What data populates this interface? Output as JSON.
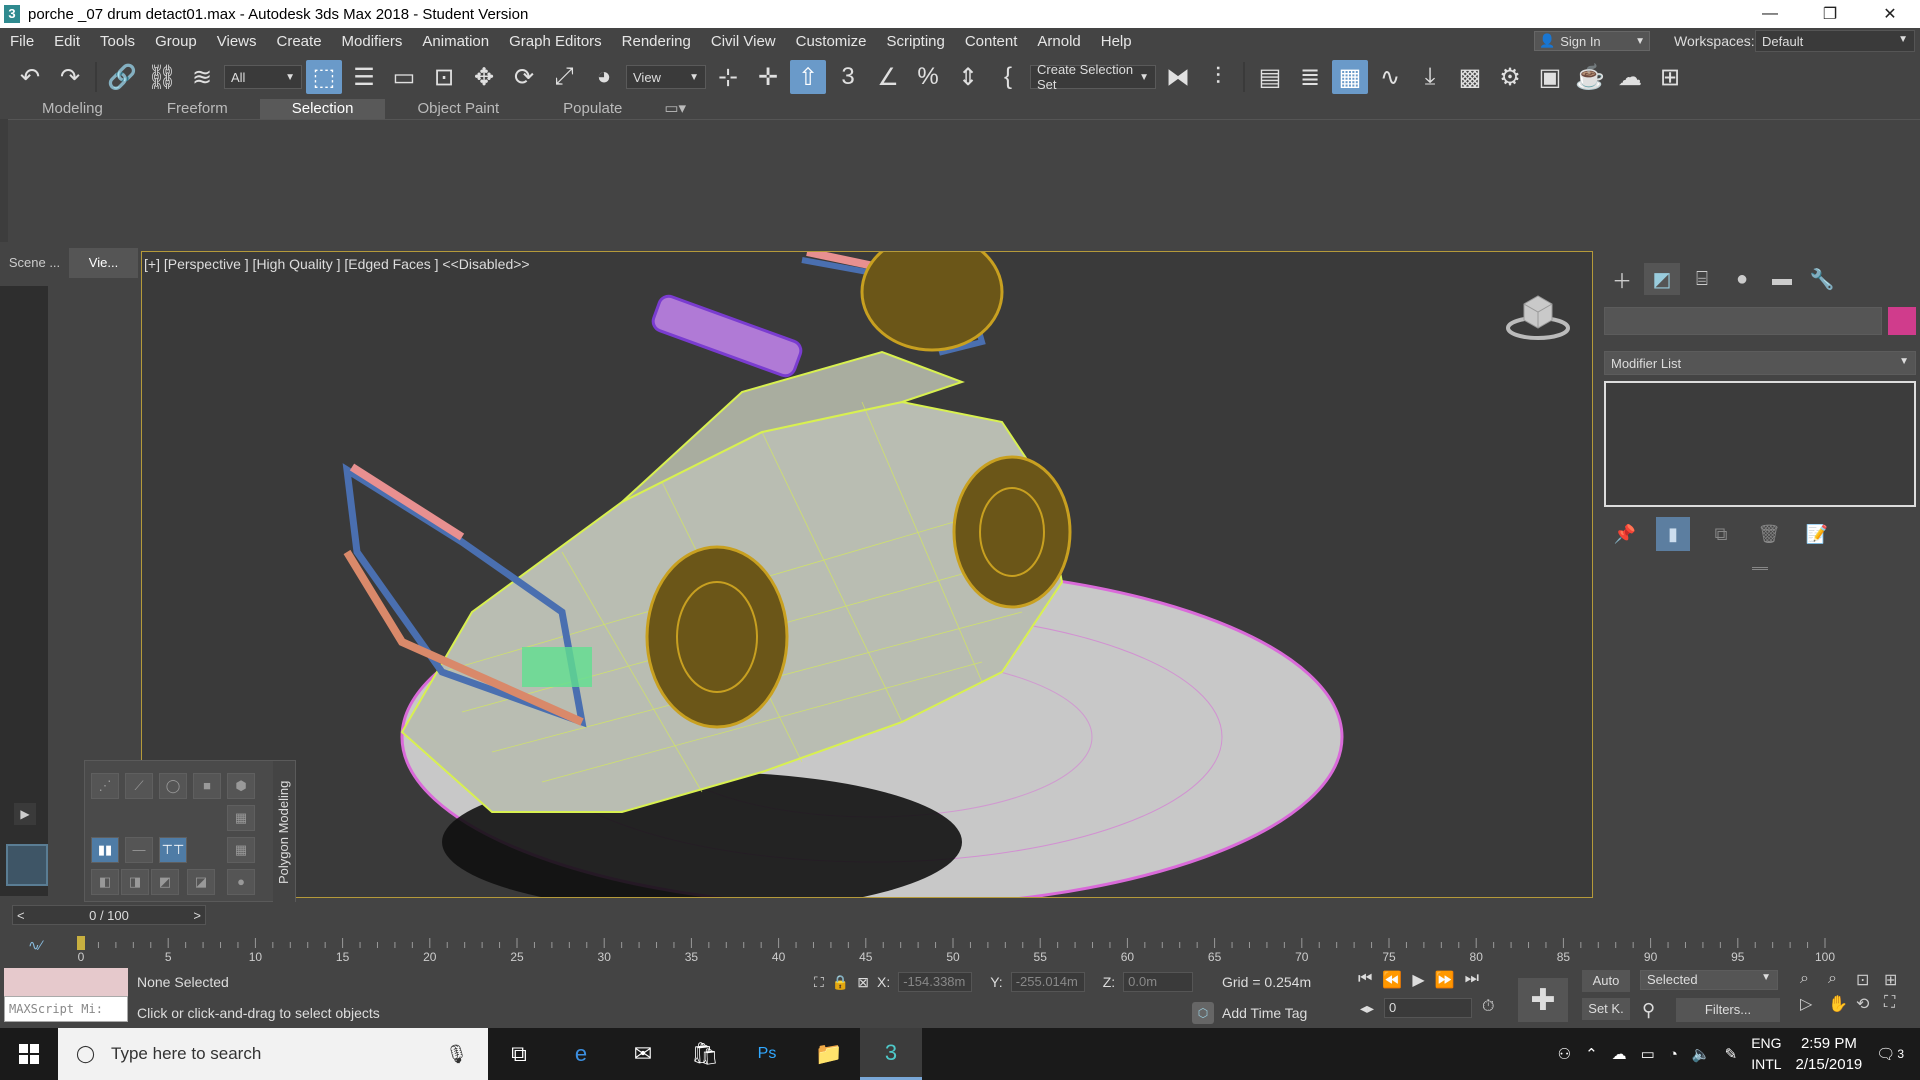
{
  "window": {
    "title": "porche _07 drum detact01.max - Autodesk 3ds Max 2018 - Student Version",
    "app_icon": "3",
    "controls": {
      "minimize": "—",
      "maximize": "❐",
      "close": "✕"
    }
  },
  "menu": [
    "File",
    "Edit",
    "Tools",
    "Group",
    "Views",
    "Create",
    "Modifiers",
    "Animation",
    "Graph Editors",
    "Rendering",
    "Civil View",
    "Customize",
    "Scripting",
    "Content",
    "Arnold",
    "Help"
  ],
  "account": {
    "signin_label": "Sign In",
    "workspaces_label": "Workspaces:",
    "workspace_value": "Default"
  },
  "toolbar": {
    "filter_value": "All",
    "refcoord_value": "View",
    "selection_set_placeholder": "Create Selection Set"
  },
  "ribbon": {
    "tabs": [
      "Modeling",
      "Freeform",
      "Selection",
      "Object Paint",
      "Populate"
    ],
    "active_tab": "Selection"
  },
  "left_panel": {
    "tabs": [
      "Scene ...",
      "Vie..."
    ]
  },
  "viewport": {
    "label": "[+] [Perspective ] [High Quality ] [Edged Faces ]  <<Disabled>>"
  },
  "caddy": {
    "label": "Polygon Modeling"
  },
  "command_panel": {
    "modifier_list_label": "Modifier List",
    "object_color": "#d03c8c"
  },
  "timeline": {
    "slider_value": "0 / 100",
    "prev": "<",
    "next": ">",
    "ticks": [
      "0",
      "5",
      "10",
      "15",
      "20",
      "25",
      "30",
      "35",
      "40",
      "45",
      "50",
      "55",
      "60",
      "65",
      "70",
      "75",
      "80",
      "85",
      "90",
      "95",
      "100"
    ]
  },
  "status": {
    "maxscript_placeholder": "MAXScript Mi:",
    "selection": "None Selected",
    "prompt": "Click or click-and-drag to select objects",
    "x_label": "X:",
    "x_value": "-154.338m",
    "y_label": "Y:",
    "y_value": "-255.014m",
    "z_label": "Z:",
    "z_value": "0.0m",
    "grid": "Grid = 0.254m",
    "time_tag": "Add Time Tag",
    "frame_value": "0",
    "auto_label": "Auto",
    "setkey_label": "Set K.",
    "selected_value": "Selected",
    "filters_label": "Filters..."
  },
  "taskbar": {
    "search_placeholder": "Type here to search",
    "lang_top": "ENG",
    "lang_bottom": "INTL",
    "time": "2:59 PM",
    "date": "2/15/2019",
    "notifications": "3"
  }
}
